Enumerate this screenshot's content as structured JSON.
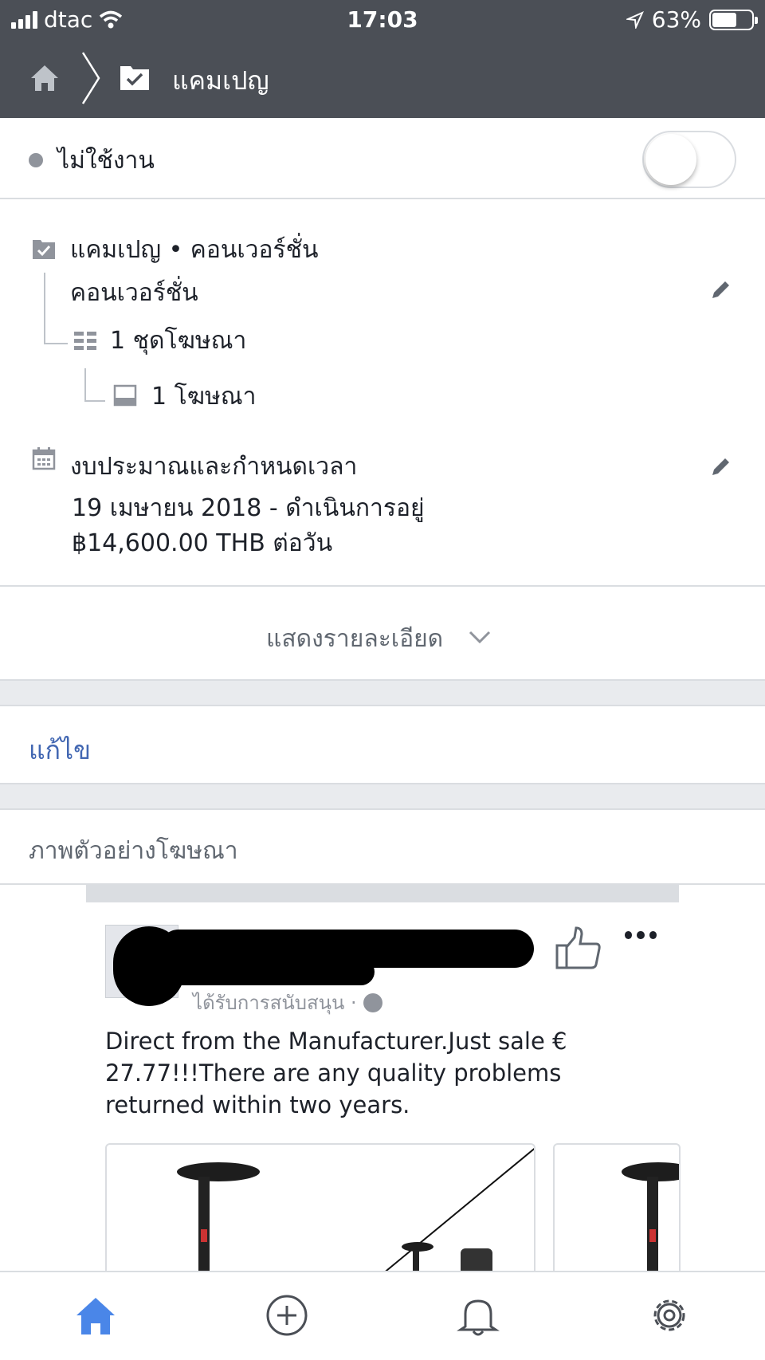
{
  "status_bar": {
    "carrier": "dtac",
    "time": "17:03",
    "battery": "63%",
    "battery_level": 0.63
  },
  "nav": {
    "home_icon": "home-icon",
    "title": "แคมเปญ"
  },
  "campaign_status": {
    "label": "ไม่ใช้งาน",
    "toggle_on": false
  },
  "campaign": {
    "line1": "แคมเปญ • คอนเวอร์ชั่น",
    "line2": "คอนเวอร์ชั่น",
    "adsets": "1 ชุดโฆษณา",
    "ads": "1 โฆษณา"
  },
  "budget": {
    "title": "งบประมาณและกำหนดเวลา",
    "date": "19 เมษายน 2018 - ดำเนินการอยู่",
    "amount": "฿14,600.00 THB ต่อวัน"
  },
  "show_details": "แสดงรายละเอียด",
  "edit": "แก้ไข",
  "preview": {
    "header": "ภาพตัวอย่างโฆษณา",
    "sponsored": "ได้รับการสนับสนุน ·",
    "ad_text": "Direct from the Manufacturer.Just sale € 27.77!!!There are any quality problems returned within two years."
  },
  "colors": {
    "header_bg": "#4b4f56",
    "link_blue": "#4267b2",
    "tab_active": "#4a86e8"
  },
  "tabs": [
    "home-icon",
    "add-circle-icon",
    "bell-icon",
    "gear-icon"
  ]
}
